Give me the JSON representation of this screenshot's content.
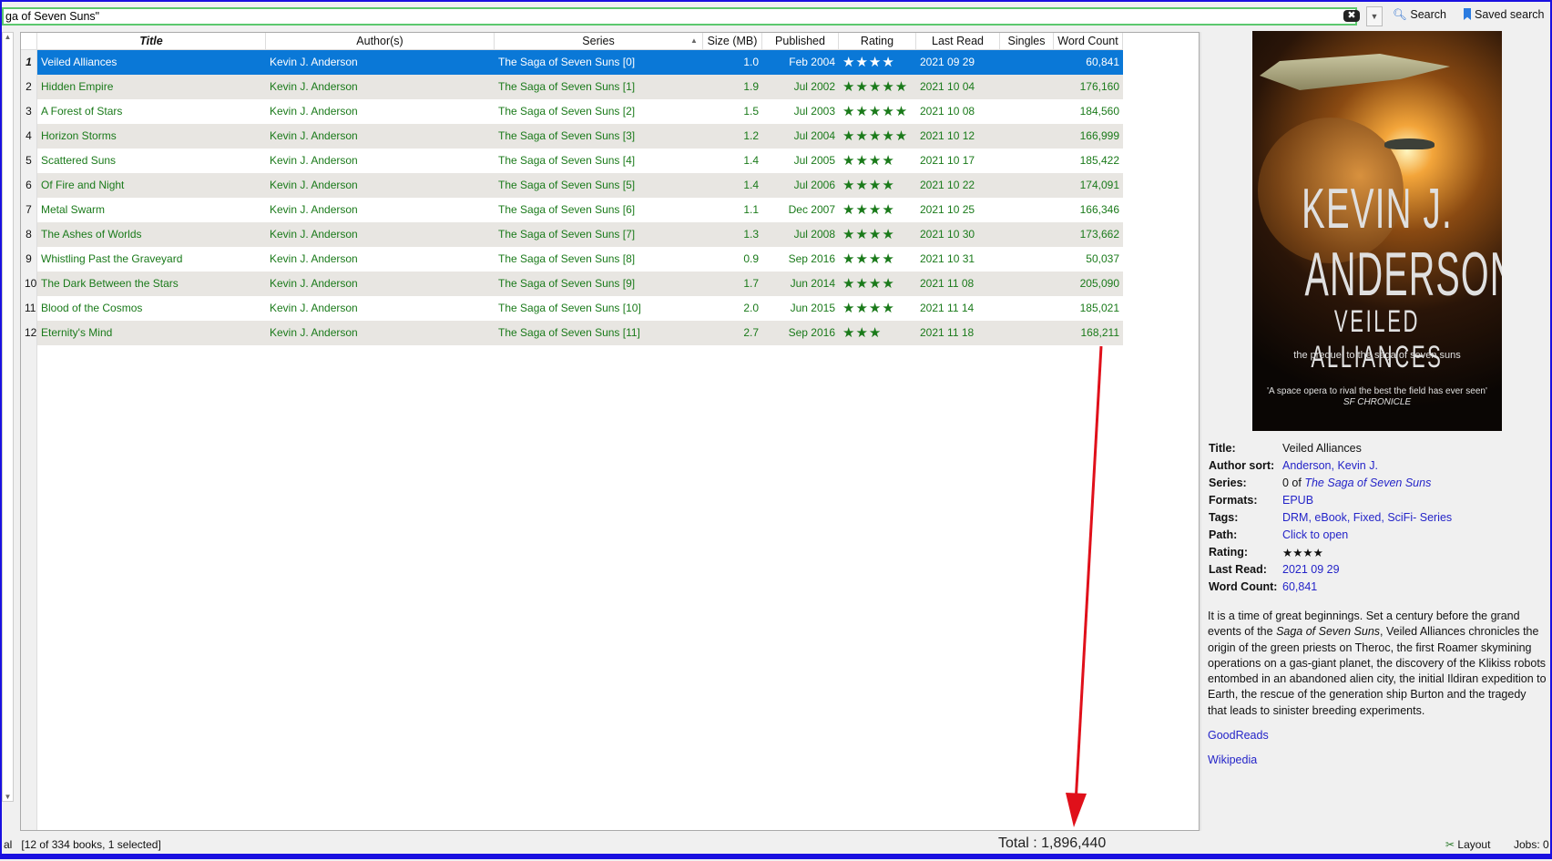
{
  "search": {
    "value": "ga of Seven Suns\"",
    "clear_icon": "clear-icon",
    "search_label": "Search",
    "saved_search_label": "Saved search"
  },
  "table": {
    "columns": [
      "",
      "Title",
      "Author(s)",
      "Series",
      "Size (MB)",
      "Published",
      "Rating",
      "Last Read",
      "Singles",
      "Word Count"
    ],
    "sort_column": "Series",
    "rows": [
      {
        "n": "1",
        "title": "Veiled Alliances",
        "author": "Kevin J. Anderson",
        "series": "The Saga of Seven Suns [0]",
        "size": "1.0",
        "published": "Feb 2004",
        "rating": 4,
        "stars": "★★★★",
        "last_read": "2021 09 29",
        "singles": "",
        "words": "60,841",
        "selected": true
      },
      {
        "n": "2",
        "title": "Hidden Empire",
        "author": "Kevin J. Anderson",
        "series": "The Saga of Seven Suns [1]",
        "size": "1.9",
        "published": "Jul 2002",
        "rating": 5,
        "stars": "★★★★★",
        "last_read": "2021 10 04",
        "singles": "",
        "words": "176,160"
      },
      {
        "n": "3",
        "title": "A Forest of Stars",
        "author": "Kevin J. Anderson",
        "series": "The Saga of Seven Suns [2]",
        "size": "1.5",
        "published": "Jul 2003",
        "rating": 5,
        "stars": "★★★★★",
        "last_read": "2021 10 08",
        "singles": "",
        "words": "184,560"
      },
      {
        "n": "4",
        "title": "Horizon Storms",
        "author": "Kevin J. Anderson",
        "series": "The Saga of Seven Suns [3]",
        "size": "1.2",
        "published": "Jul 2004",
        "rating": 5,
        "stars": "★★★★★",
        "last_read": "2021 10 12",
        "singles": "",
        "words": "166,999"
      },
      {
        "n": "5",
        "title": "Scattered Suns",
        "author": "Kevin J. Anderson",
        "series": "The Saga of Seven Suns [4]",
        "size": "1.4",
        "published": "Jul 2005",
        "rating": 4,
        "stars": "★★★★",
        "last_read": "2021 10 17",
        "singles": "",
        "words": "185,422"
      },
      {
        "n": "6",
        "title": "Of Fire and Night",
        "author": "Kevin J. Anderson",
        "series": "The Saga of Seven Suns [5]",
        "size": "1.4",
        "published": "Jul 2006",
        "rating": 4,
        "stars": "★★★★",
        "last_read": "2021 10 22",
        "singles": "",
        "words": "174,091"
      },
      {
        "n": "7",
        "title": "Metal Swarm",
        "author": "Kevin J. Anderson",
        "series": "The Saga of Seven Suns [6]",
        "size": "1.1",
        "published": "Dec 2007",
        "rating": 4,
        "stars": "★★★★",
        "last_read": "2021 10 25",
        "singles": "",
        "words": "166,346"
      },
      {
        "n": "8",
        "title": "The Ashes of Worlds",
        "author": "Kevin J. Anderson",
        "series": "The Saga of Seven Suns [7]",
        "size": "1.3",
        "published": "Jul 2008",
        "rating": 4,
        "stars": "★★★★",
        "last_read": "2021 10 30",
        "singles": "",
        "words": "173,662"
      },
      {
        "n": "9",
        "title": "Whistling Past the Graveyard",
        "author": "Kevin J. Anderson",
        "series": "The Saga of Seven Suns [8]",
        "size": "0.9",
        "published": "Sep 2016",
        "rating": 4,
        "stars": "★★★★",
        "last_read": "2021 10 31",
        "singles": "",
        "words": "50,037"
      },
      {
        "n": "10",
        "title": "The Dark Between the Stars",
        "author": "Kevin J. Anderson",
        "series": "The Saga of Seven Suns [9]",
        "size": "1.7",
        "published": "Jun 2014",
        "rating": 4,
        "stars": "★★★★",
        "last_read": "2021 11 08",
        "singles": "",
        "words": "205,090"
      },
      {
        "n": "11",
        "title": "Blood of the Cosmos",
        "author": "Kevin J. Anderson",
        "series": "The Saga of Seven Suns [10]",
        "size": "2.0",
        "published": "Jun 2015",
        "rating": 4,
        "stars": "★★★★",
        "last_read": "2021 11 14",
        "singles": "",
        "words": "185,021"
      },
      {
        "n": "12",
        "title": "Eternity's Mind",
        "author": "Kevin J. Anderson",
        "series": "The Saga of Seven Suns [11]",
        "size": "2.7",
        "published": "Sep 2016",
        "rating": 3,
        "stars": "★★★",
        "last_read": "2021 11 18",
        "singles": "",
        "words": "168,211"
      }
    ]
  },
  "cover": {
    "author_line1": "KEVIN J.",
    "author_line2": "ANDERSON",
    "title": "VEILED ALLIANCES",
    "tagline": "the prequel to the saga of seven suns",
    "quote": "'A space opera to rival the best the field has ever seen'",
    "quote_source": "SF CHRONICLE"
  },
  "details": {
    "title_label": "Title:",
    "title": "Veiled Alliances",
    "author_sort_label": "Author sort:",
    "author_sort": "Anderson, Kevin J.",
    "series_label": "Series:",
    "series_prefix": "0 of",
    "series": "The Saga of Seven Suns",
    "formats_label": "Formats:",
    "formats": "EPUB",
    "tags_label": "Tags:",
    "tags": "DRM, eBook, Fixed, SciFi- Series",
    "path_label": "Path:",
    "path": "Click to open",
    "rating_label": "Rating:",
    "rating": "★★★★",
    "last_read_label": "Last Read:",
    "last_read": "2021 09 29",
    "word_count_label": "Word Count:",
    "word_count": "60,841",
    "desc_1": "It is a time of great beginnings. Set a century before the grand events of the ",
    "desc_em": "Saga of Seven Suns",
    "desc_2": ", Veiled Alliances chronicles the origin of the green priests on Theroc, the first Roamer skymining operations on a gas-giant planet, the discovery of the Klikiss robots entombed in an abandoned alien city, the initial Ildiran expedition to Earth, the rescue of the generation ship Burton and the tragedy that leads to sinister breeding experiments.",
    "goodreads": "GoodReads",
    "wikipedia": "Wikipedia"
  },
  "status": {
    "left_fragment": "al",
    "books": "[12 of 334 books, 1 selected]",
    "total": "Total : 1,896,440",
    "layout": "Layout",
    "jobs": "Jobs: 0"
  },
  "colors": {
    "accent": "#0a78d7",
    "row_text": "#1a7a1a",
    "link": "#2424c8",
    "annotation_arrow": "#e0101a",
    "window_border": "#1a10e0"
  }
}
